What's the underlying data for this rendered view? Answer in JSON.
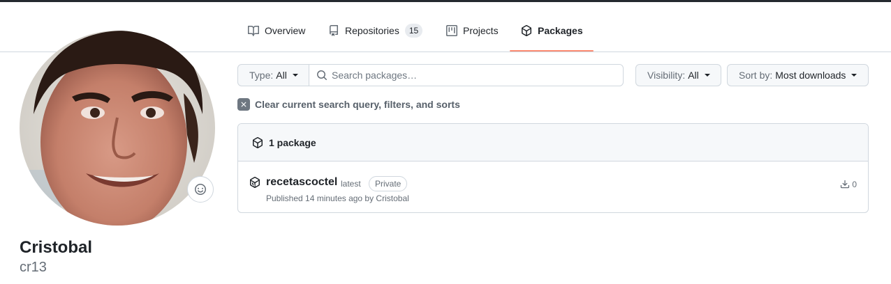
{
  "nav": {
    "tabs": [
      {
        "label": "Overview",
        "icon": "book-icon"
      },
      {
        "label": "Repositories",
        "icon": "repo-icon",
        "count": "15"
      },
      {
        "label": "Projects",
        "icon": "project-icon"
      },
      {
        "label": "Packages",
        "icon": "package-icon",
        "selected": true
      }
    ]
  },
  "profile": {
    "fullname": "Cristobal",
    "username": "cr13"
  },
  "filters": {
    "type_prefix": "Type:",
    "type_value": "All",
    "search_placeholder": "Search packages…",
    "visibility_prefix": "Visibility:",
    "visibility_value": "All",
    "sort_prefix": "Sort by:",
    "sort_value": "Most downloads",
    "clear_label": "Clear current search query, filters, and sorts"
  },
  "packages": {
    "header": "1 package",
    "items": [
      {
        "name": "recetascoctel",
        "tag": "latest",
        "visibility": "Private",
        "meta": "Published 14 minutes ago by Cristobal",
        "downloads": "0"
      }
    ]
  },
  "colors": {
    "accent_underline": "#fd8c73",
    "border": "#d0d7de",
    "muted_text": "#656d76"
  }
}
